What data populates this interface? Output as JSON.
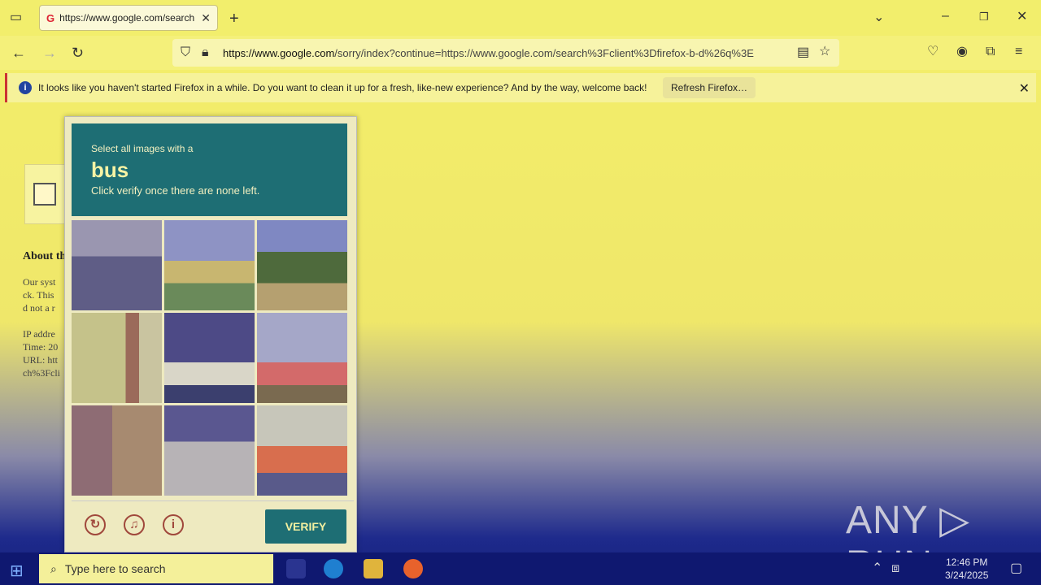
{
  "browser": {
    "tab_title": "https://www.google.com/search",
    "url_domain": "https://www.google.com",
    "url_rest": "/sorry/index?continue=https://www.google.com/search%3Fclient%3Dfirefox-b-d%26q%3E",
    "icons": [
      "tab-list-icon",
      "close-tab-icon",
      "new-tab-icon",
      "back-icon",
      "forward-icon",
      "reload-icon",
      "shield-icon",
      "lock-icon",
      "reader-icon",
      "bookmark-star-icon",
      "pocket-icon",
      "account-icon",
      "extensions-icon",
      "menu-icon"
    ]
  },
  "notification": {
    "message": "It looks like you haven't started Firefox in a while. Do you want to clean it up for a fresh, like-new experience? And by the way, welcome back!",
    "button": "Refresh Firefox…"
  },
  "page": {
    "about_heading": "About th",
    "para1_line1": "Our syst",
    "para1_line2": "ck. This",
    "para1_line3": "d not a r",
    "ip_line": "IP addre",
    "time_line": "Time: 20",
    "url_line": "URL: htt",
    "extra_line": "ch%3Fcli"
  },
  "captcha": {
    "instruction": "Select all images with a",
    "target": "bus",
    "subtext": "Click verify once there are none left.",
    "verify_label": "VERIFY",
    "footer_icons": [
      "reload-icon",
      "audio-icon",
      "info-icon"
    ]
  },
  "watermark": "ANY ▷ RUN",
  "taskbar": {
    "search_placeholder": "Type here to search",
    "time": "12:46 PM",
    "date": "3/24/2025"
  }
}
